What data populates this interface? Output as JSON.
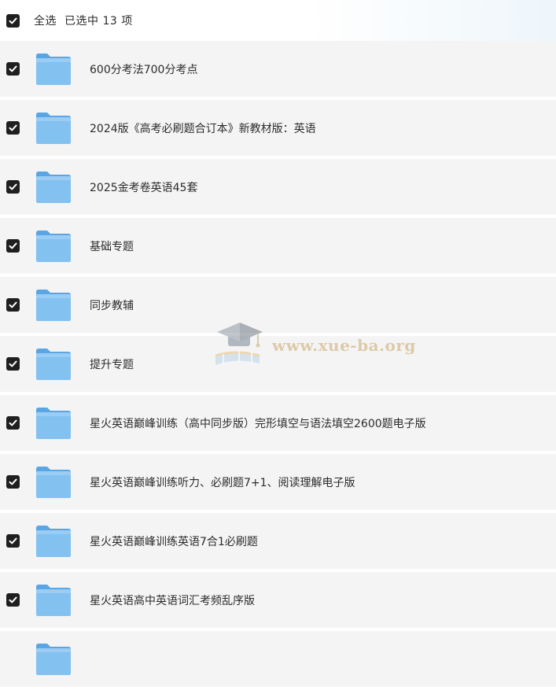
{
  "header": {
    "select_all_label": "全选",
    "selected_count_text": "已选中  13  项"
  },
  "items": [
    {
      "title": "600分考法700分考点",
      "checked": true,
      "icon": "folder-icon"
    },
    {
      "title": "2024版《高考必刷题合订本》新教材版：英语",
      "checked": true,
      "icon": "folder-icon"
    },
    {
      "title": "2025金考卷英语45套",
      "checked": true,
      "icon": "folder-icon"
    },
    {
      "title": "基础专题",
      "checked": true,
      "icon": "folder-icon"
    },
    {
      "title": "同步教辅",
      "checked": true,
      "icon": "folder-icon"
    },
    {
      "title": "提升专题",
      "checked": true,
      "icon": "folder-icon"
    },
    {
      "title": "星火英语巅峰训练（高中同步版）完形填空与语法填空2600题电子版",
      "checked": true,
      "icon": "folder-icon"
    },
    {
      "title": "星火英语巅峰训练听力、必刷题7+1、阅读理解电子版",
      "checked": true,
      "icon": "folder-icon"
    },
    {
      "title": "星火英语巅峰训练英语7合1必刷题",
      "checked": true,
      "icon": "folder-icon"
    },
    {
      "title": "星火英语高中英语词汇考频乱序版",
      "checked": true,
      "icon": "folder-icon"
    },
    {
      "title": "",
      "checked": false,
      "icon": "folder-icon"
    }
  ],
  "watermark": {
    "text": "www.xue-ba.org"
  },
  "colors": {
    "checkbox": "#1f1f1f",
    "row_background": "#f4f4f5",
    "folder_blue": "#7fbdee",
    "text": "#2b2b2b"
  }
}
